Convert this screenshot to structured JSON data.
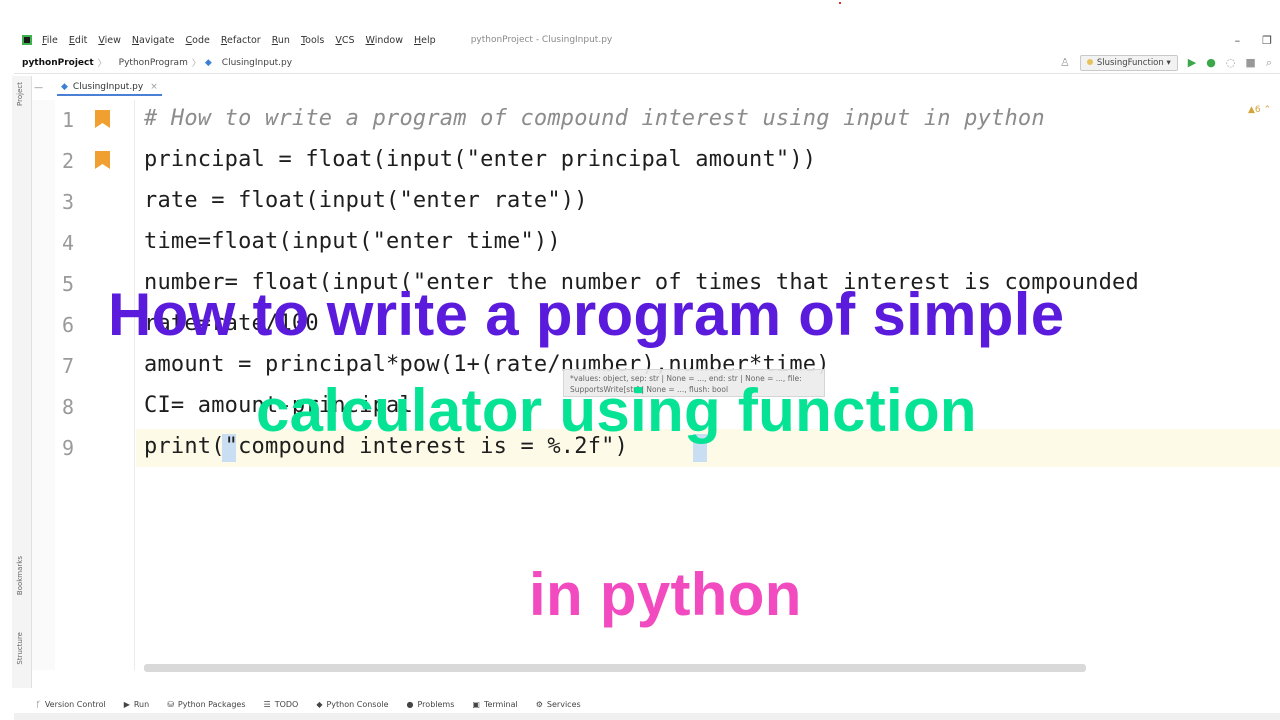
{
  "menu": {
    "items": [
      "File",
      "Edit",
      "View",
      "Navigate",
      "Code",
      "Refactor",
      "Run",
      "Tools",
      "VCS",
      "Window",
      "Help"
    ],
    "window_title": "pythonProject - ClusingInput.py",
    "minimize": "–",
    "restore": "❐"
  },
  "navbar": {
    "project": "pythonProject",
    "folder": "PythonProgram",
    "file": "ClusingInput.py",
    "run_config": "SlusingFunction"
  },
  "tab": {
    "label": "ClusingInput.py",
    "close": "×"
  },
  "editor": {
    "line_numbers": [
      "1",
      "2",
      "3",
      "4",
      "5",
      "6",
      "7",
      "8",
      "9"
    ],
    "lines": [
      "# How to write a program of compound interest using input in python",
      "principal = float(input(\"enter principal amount\"))",
      "rate = float(input(\"enter rate\"))",
      "time=float(input(\"enter time\"))",
      "number= float(input(\"enter the number of times that interest is compounded",
      "rate=rate/100",
      "amount = principal*pow(1+(rate/number),number*time)",
      "CI= amount-principal",
      "print(\"compound interest is = %.2f\")"
    ],
    "warning_counter": "▲6 ⌃",
    "param_hint": "*values: object, sep: str | None = ..., end: str | None = ..., file: SupportsWrite[str] | None = ..., flush: bool"
  },
  "bottom_tools": [
    "Version Control",
    "Run",
    "Python Packages",
    "TODO",
    "Python Console",
    "Problems",
    "Terminal",
    "Services"
  ],
  "side_tools": [
    "Project",
    "Bookmarks",
    "Structure"
  ],
  "overlay": {
    "line1": "How to write a program of simple",
    "line2": "calculator using function",
    "line3": "in python"
  },
  "colors": {
    "overlay_line1": "#5b1bdc",
    "overlay_line2": "#07e394",
    "overlay_line3": "#f24bc0",
    "bookmark": "#f0a030"
  }
}
